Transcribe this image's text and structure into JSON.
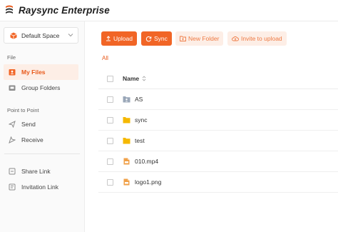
{
  "header": {
    "app_name": "Raysync Enterprise",
    "logo_icon": "raysync-logo-icon"
  },
  "sidebar": {
    "space_selector": {
      "label": "Default Space",
      "icon": "cube-icon"
    },
    "sections": [
      {
        "label": "File"
      },
      {
        "label": "Point to Point"
      }
    ],
    "items": [
      {
        "label": "My Files",
        "icon": "user-folder-icon",
        "active": true
      },
      {
        "label": "Group Folders",
        "icon": "group-folder-icon"
      },
      {
        "label": "Send",
        "icon": "send-icon"
      },
      {
        "label": "Receive",
        "icon": "receive-icon"
      },
      {
        "label": "Share Link",
        "icon": "share-link-icon"
      },
      {
        "label": "Invitation Link",
        "icon": "invitation-link-icon"
      }
    ]
  },
  "toolbar": {
    "upload_label": "Upload",
    "sync_label": "Sync",
    "new_folder_label": "New Folder",
    "invite_label": "Invite to upload"
  },
  "breadcrumb": {
    "root": "All"
  },
  "file_table": {
    "header_name": "Name",
    "rows": [
      {
        "name": "AS",
        "type": "shared-folder"
      },
      {
        "name": "sync",
        "type": "folder"
      },
      {
        "name": "test",
        "type": "folder"
      },
      {
        "name": "010.mp4",
        "type": "file"
      },
      {
        "name": "logo1.png",
        "type": "file"
      }
    ]
  },
  "colors": {
    "accent": "#f16526",
    "accent_light": "#fdeee6",
    "folder": "#f5b800",
    "shared_folder": "#9aa7b8"
  }
}
